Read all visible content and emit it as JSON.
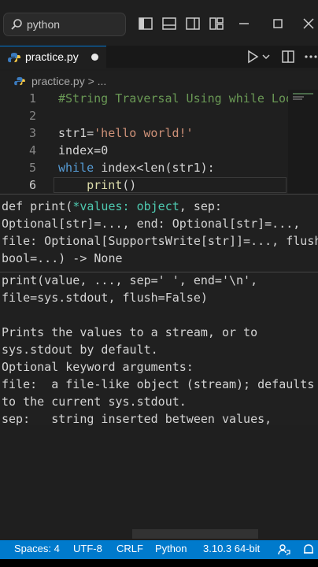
{
  "titlebar": {
    "search_text": "python",
    "icons": [
      "search-icon",
      "toggle-primary-sidebar-icon",
      "toggle-panel-icon",
      "toggle-secondary-sidebar-icon",
      "customize-layout-icon",
      "minimize-icon",
      "maximize-icon",
      "close-icon"
    ]
  },
  "tab": {
    "name": "practice.py",
    "modified": true,
    "icon": "python-file-icon"
  },
  "editor_actions": [
    "run-icon",
    "run-dropdown-icon",
    "split-editor-icon",
    "more-actions-icon"
  ],
  "breadcrumb": {
    "text": "practice.py > ..."
  },
  "code": {
    "line_numbers": [
      "1",
      "2",
      "3",
      "4",
      "5",
      "6"
    ],
    "current_line": 6,
    "lines": [
      [
        {
          "t": "#String Traversal Using while Loo",
          "c": "cm"
        }
      ],
      [],
      [
        {
          "t": "str1",
          "c": "plain"
        },
        {
          "t": "=",
          "c": "plain"
        },
        {
          "t": "'hello world!'",
          "c": "str"
        }
      ],
      [
        {
          "t": "index",
          "c": "plain"
        },
        {
          "t": "=",
          "c": "plain"
        },
        {
          "t": "0",
          "c": "plain"
        }
      ],
      [
        {
          "t": "while ",
          "c": "kw"
        },
        {
          "t": "index",
          "c": "plain"
        },
        {
          "t": "<",
          "c": "plain"
        },
        {
          "t": "len",
          "c": "plain"
        },
        {
          "t": "(str1):",
          "c": "plain"
        }
      ],
      [
        {
          "t": "    print",
          "c": "fn"
        },
        {
          "t": "()",
          "c": "plain"
        }
      ]
    ]
  },
  "popup": {
    "signature_lines": [
      [
        {
          "t": "def print(",
          "c": ""
        },
        {
          "t": "*values: object",
          "c": "ty"
        },
        {
          "t": ", sep:",
          "c": ""
        }
      ],
      [
        {
          "t": "Optional[str]=..., end: Optional[str]=...,",
          "c": ""
        }
      ],
      [
        {
          "t": "file: Optional[SupportsWrite[str]]=..., flush:",
          "c": ""
        }
      ],
      [
        {
          "t": "bool=...) -> None",
          "c": ""
        }
      ]
    ],
    "doc_lines": [
      "print(value, ..., sep=' ', end='\\n',",
      "file=sys.stdout, flush=False)",
      "",
      "Prints the values to a stream, or to",
      "sys.stdout by default.",
      "Optional keyword arguments:",
      "file:  a file-like object (stream); defaults",
      "to the current sys.stdout.",
      "sep:   string inserted between values,"
    ]
  },
  "statusbar": {
    "spaces": "Spaces: 4",
    "encoding": "UTF-8",
    "eol": "CRLF",
    "language": "Python",
    "interpreter": "3.10.3 64-bit",
    "icons": [
      "feedback-icon",
      "notifications-icon"
    ]
  },
  "colors": {
    "status_bar": "#007acc",
    "keyword": "#569cd6",
    "comment": "#6a9955",
    "string": "#ce9178",
    "function": "#dcdcaa"
  }
}
